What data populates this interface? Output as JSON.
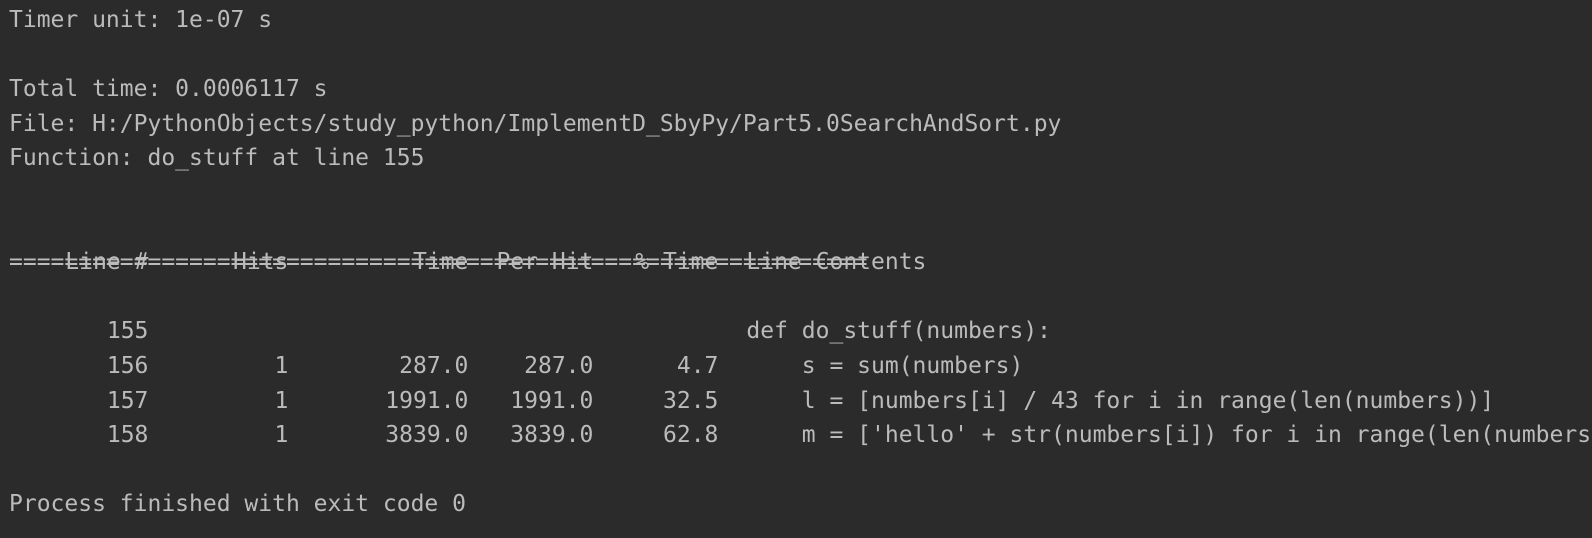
{
  "console": {
    "timer_unit": "Timer unit: 1e-07 s",
    "total_time": "Total time: 0.0006117 s",
    "file": "File: H:/PythonObjects/study_python/ImplementD_SbyPy/Part5.0SearchAndSort.py",
    "function": "Function: do_stuff at line 155",
    "headers": {
      "line": "Line #",
      "hits": "Hits",
      "time": "Time",
      "per_hit": "Per Hit",
      "pct_time": "% Time",
      "contents": "Line Contents"
    },
    "separator": "==============================================================",
    "rows": [
      {
        "line": "155",
        "hits": "",
        "time": "",
        "per_hit": "",
        "pct_time": "",
        "contents": "def do_stuff(numbers):"
      },
      {
        "line": "156",
        "hits": "1",
        "time": "287.0",
        "per_hit": "287.0",
        "pct_time": "4.7",
        "contents": "    s = sum(numbers)"
      },
      {
        "line": "157",
        "hits": "1",
        "time": "1991.0",
        "per_hit": "1991.0",
        "pct_time": "32.5",
        "contents": "    l = [numbers[i] / 43 for i in range(len(numbers))]"
      },
      {
        "line": "158",
        "hits": "1",
        "time": "3839.0",
        "per_hit": "3839.0",
        "pct_time": "62.8",
        "contents": "    m = ['hello' + str(numbers[i]) for i in range(len(numbers))]"
      }
    ],
    "exit_message": "Process finished with exit code 0"
  }
}
